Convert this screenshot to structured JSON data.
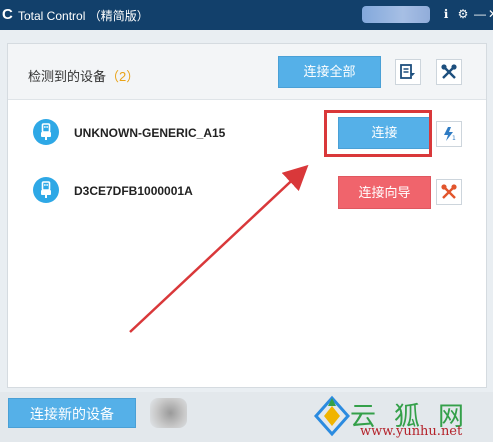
{
  "window": {
    "app_logo": "C",
    "title": "Total Control （精简版）",
    "buttons": {
      "info_icon": "ℹ",
      "settings_icon": "⚙",
      "minimize_icon": "—",
      "close_icon": "✕"
    }
  },
  "header": {
    "detected_label": "检测到的设备",
    "detected_count": "（2）",
    "connect_all_label": "连接全部"
  },
  "devices": [
    {
      "name": "UNKNOWN-GENERIC_A15",
      "action_label": "连接",
      "action_style": "blue"
    },
    {
      "name": "D3CE7DFB1000001A",
      "action_label": "连接向导",
      "action_style": "red"
    }
  ],
  "footer": {
    "connect_new_label": "连接新的设备"
  },
  "watermark": {
    "chars": "云狐网",
    "url": "www.yunhu.net"
  },
  "colors": {
    "titlebar": "#12406b",
    "accent_blue": "#55b0e8",
    "accent_red": "#f0646c",
    "annotation_red": "#d9383a",
    "usb_blue": "#2ea8e6"
  }
}
